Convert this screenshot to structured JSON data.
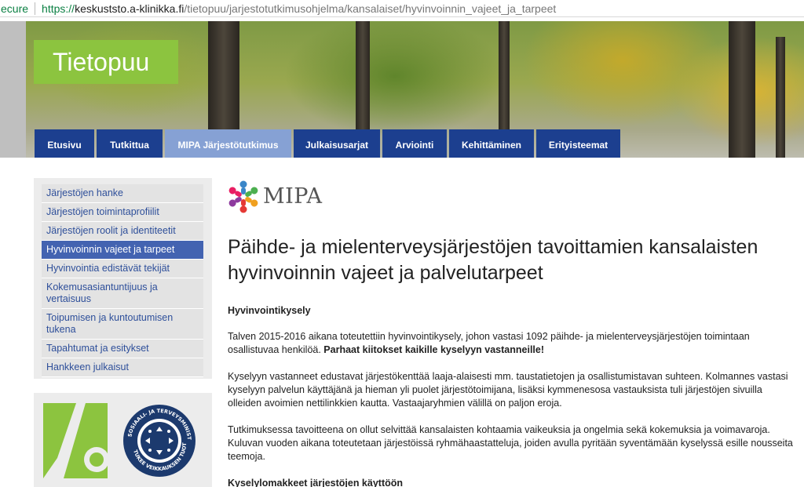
{
  "browser": {
    "secure_label": "ecure",
    "url_scheme": "https://",
    "url_host": "keskuststo.a-klinikka.fi",
    "url_path": "/tietopuu/jarjestotutkimusohjelma/kansalaiset/hyvinvoinnin_vajeet_ja_tarpeet"
  },
  "header": {
    "logo_text": "Tietopuu",
    "logo_color": "#8cc43f",
    "nav": [
      {
        "label": "Etusivu",
        "active": false
      },
      {
        "label": "Tutkittua",
        "active": false
      },
      {
        "label": "MIPA Järjestötutkimus",
        "active": true
      },
      {
        "label": "Julkaisusarjat",
        "active": false
      },
      {
        "label": "Arviointi",
        "active": false
      },
      {
        "label": "Kehittäminen",
        "active": false
      },
      {
        "label": "Erityisteemat",
        "active": false
      }
    ],
    "nav_color": "#1c3f8f",
    "nav_active_color": "#86a1d4"
  },
  "sidebar": {
    "items": [
      {
        "label": "Järjestöjen hanke",
        "active": false
      },
      {
        "label": "Järjestöjen toimintaprofiilit",
        "active": false
      },
      {
        "label": "Järjestöjen roolit ja identiteetit",
        "active": false
      },
      {
        "label": "Hyvinvoinnin vajeet ja tarpeet",
        "active": true
      },
      {
        "label": "Hyvinvointia edistävät tekijät",
        "active": false
      },
      {
        "label": "Kokemusasiantuntijuus ja vertaisuus",
        "active": false
      },
      {
        "label": "Toipumisen ja kuntoutumisen tukena",
        "active": false
      },
      {
        "label": "Tapahtumat ja esitykset",
        "active": false
      },
      {
        "label": "Hankkeen julkaisut",
        "active": false
      }
    ],
    "active_color": "#4363b1",
    "logos": {
      "ministry_text": "SOSIAALI- JA TERVEYSMINISTERIÖ",
      "ministry_sub": "TUKEE VEIKKAUKSEN TUOTOILLA"
    }
  },
  "main": {
    "brand_text": "MIPA",
    "title": "Päihde- ja mielenterveysjärjestöjen tavoittamien kansalaisten hyvinvoinnin vajeet ja palvelutarpeet",
    "section1_heading": "Hyvinvointikysely",
    "p1_text": "Talven 2015-2016 aikana toteutettiin hyvinvointikysely, johon vastasi 1092 päihde- ja mielenterveysjärjestöjen toimintaan osallistuvaa henkilöä. ",
    "p1_bold": "Parhaat kiitokset kaikille kyselyyn vastanneille!",
    "p2": "Kyselyyn vastanneet edustavat järjestökenttää laaja-alaisesti mm. taustatietojen ja osallistumistavan suhteen. Kolmannes vastasi kyselyyn palvelun käyttäjänä ja hieman yli puolet järjestötoimijana, lisäksi kymmenesosa vastauksista tuli järjestöjen sivuilla olleiden avoimien nettilinkkien kautta. Vastaajaryhmien välillä on paljon eroja.",
    "p3": "Tutkimuksessa tavoitteena on ollut selvittää kansalaisten kohtaamia vaikeuksia ja ongelmia sekä kokemuksia ja voimavaroja. Kuluvan vuoden aikana toteutetaan järjestöissä ryhmähaastatteluja, joiden avulla pyritään syventämään kyselyssä esille nousseita teemoja.",
    "section2_heading": "Kyselylomakkeet järjestöjen käyttöön"
  }
}
